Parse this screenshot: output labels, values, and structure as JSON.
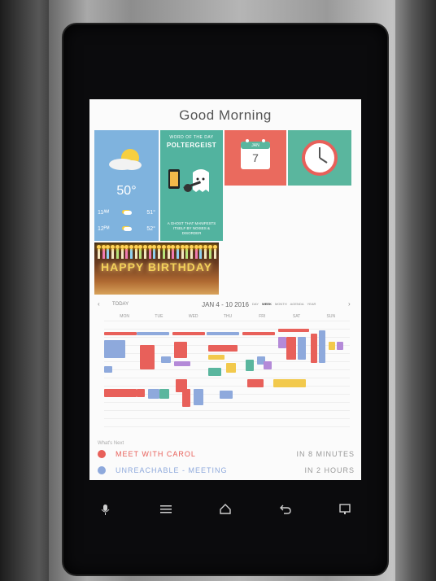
{
  "header": {
    "greeting": "Good Morning"
  },
  "weather": {
    "current_temp": "50°",
    "forecast": [
      {
        "time": "11ᴬᴹ",
        "temp": "51°"
      },
      {
        "time": "12ᴾᴹ",
        "temp": "52°"
      }
    ]
  },
  "word_of_day": {
    "label": "WORD OF THE DAY",
    "word": "POLTERGEIST",
    "definition": "A GHOST THAT MANIFESTS ITSELF BY NOISES & DISORDER"
  },
  "calendar_tile": {
    "month": "JAN",
    "day": "7"
  },
  "birthday": {
    "text": "HAPPY BIRTHDAY"
  },
  "calendar": {
    "prev_label": "‹",
    "today_label": "TODAY",
    "range": "JAN 4 - 10 2016",
    "views": [
      "DAY",
      "WEEK",
      "MONTH",
      "AGENDA",
      "YEAR"
    ],
    "next_label": "›",
    "days": [
      "MON",
      "TUE",
      "WED",
      "THU",
      "FRI",
      "SAT",
      "SUN"
    ]
  },
  "whats_next": {
    "label": "What's Next",
    "items": [
      {
        "name": "MEET WITH CAROL",
        "when": "IN 8 MINUTES",
        "color": "#e8605a"
      },
      {
        "name": "UNREACHABLE - MEETING",
        "when": "IN 2 HOURS",
        "color": "#8ea9dc"
      }
    ]
  },
  "colors": {
    "weather": "#7fb3de",
    "word": "#52b39f",
    "calendar": "#ea6a5e",
    "clock": "#5ab69e"
  },
  "nav_icons": [
    "mic-icon",
    "menu-icon",
    "home-icon",
    "back-icon",
    "cast-icon"
  ]
}
